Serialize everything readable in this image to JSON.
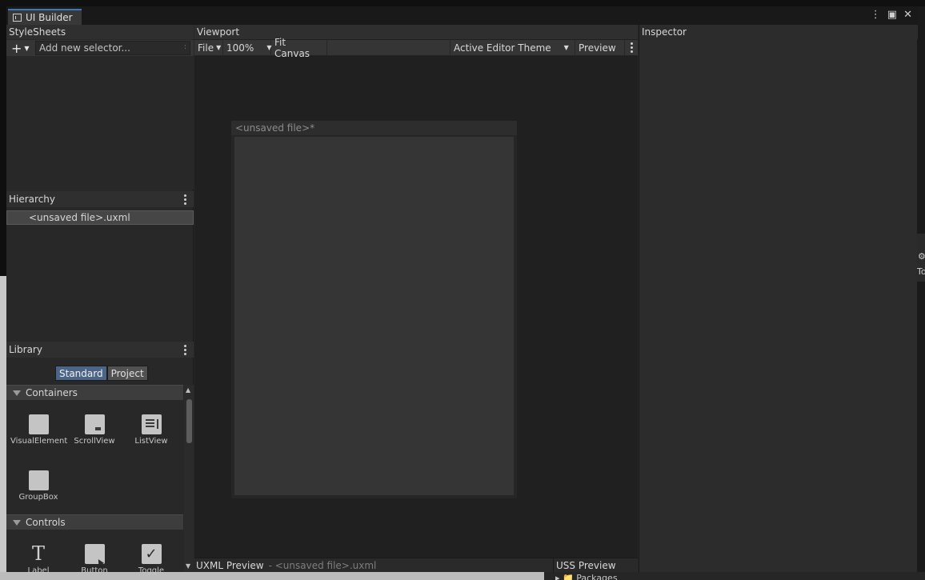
{
  "window": {
    "tab_title": "UI Builder",
    "controls": [
      "more-icon",
      "maximize-icon",
      "close-icon"
    ]
  },
  "stylesheets": {
    "title": "StyleSheets",
    "add_selector_placeholder": "Add new selector...",
    "input_dots": ":"
  },
  "hierarchy": {
    "title": "Hierarchy",
    "items": [
      "<unsaved file>.uxml"
    ]
  },
  "library": {
    "title": "Library",
    "tabs": {
      "standard": "Standard",
      "project": "Project"
    },
    "sections": [
      {
        "name": "Containers",
        "items": [
          "VisualElement",
          "ScrollView",
          "ListView",
          "GroupBox"
        ]
      },
      {
        "name": "Controls",
        "items": [
          "Label",
          "Button",
          "Toggle"
        ]
      }
    ]
  },
  "viewport": {
    "title": "Viewport",
    "toolbar": {
      "file": "File",
      "zoom": "100%",
      "fit_canvas": "Fit Canvas",
      "theme": "Active Editor Theme",
      "preview": "Preview"
    },
    "canvas_title": "<unsaved file>*",
    "uxml_preview_label": "UXML Preview",
    "uxml_preview_file": "- <unsaved file>.uxml",
    "uss_preview_label": "USS Preview"
  },
  "inspector": {
    "title": "Inspector"
  },
  "background": {
    "packages_label": "Packages",
    "right_edge_label": "To"
  },
  "colors": {
    "accent": "#3a79bb",
    "selected_tab": "#4a6587",
    "canvas": "#353535"
  }
}
